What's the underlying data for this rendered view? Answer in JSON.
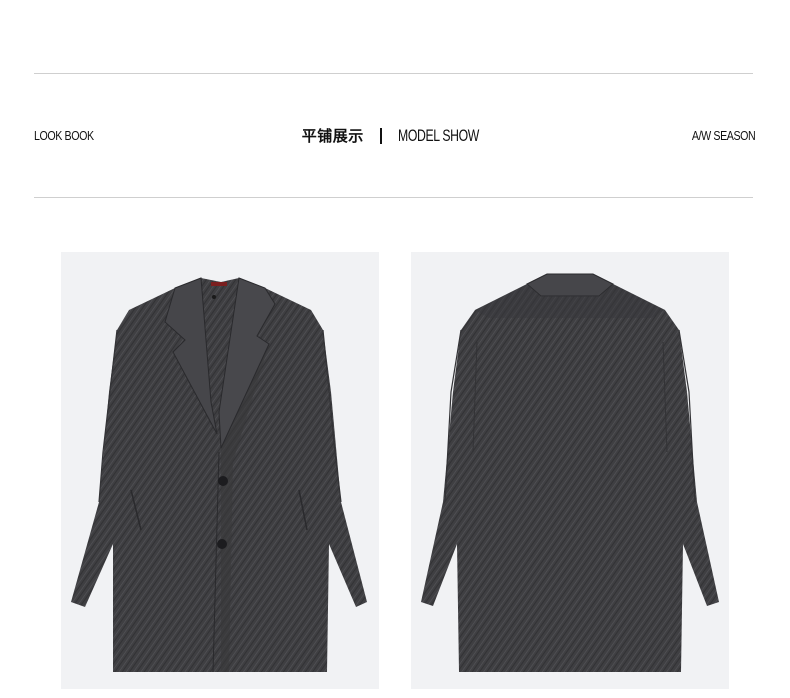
{
  "header": {
    "left_label": "LOOK BOOK",
    "title_cn": "平铺展示",
    "title_en": "MODEL SHOW",
    "right_label": "A/W SEASON"
  },
  "photos": [
    {
      "name": "coat-front",
      "icon": "coat-front-image"
    },
    {
      "name": "coat-back",
      "icon": "coat-back-image"
    }
  ],
  "colors": {
    "fabric": "#3f3f42",
    "fabric_dark": "#2c2c2f",
    "panel_bg": "#f1f2f4",
    "rule": "#cfcfcf",
    "lining": "#1f1f22",
    "label_red": "#7a1f1f"
  }
}
